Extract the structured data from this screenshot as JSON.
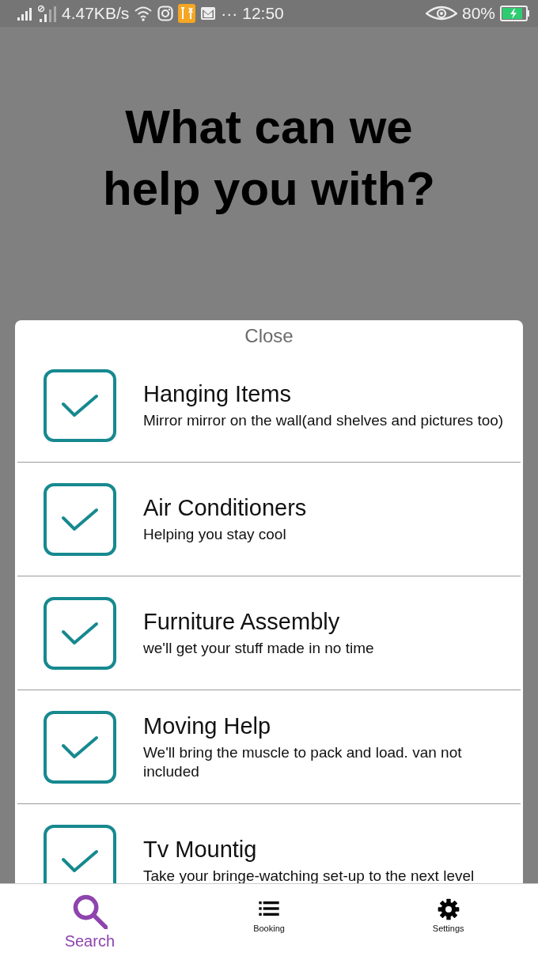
{
  "status_bar": {
    "network_speed": "4.47KB/s",
    "more": "···",
    "time": "12:50",
    "battery": "80%"
  },
  "heading": "What can we help you with?",
  "sheet": {
    "close": "Close",
    "services": [
      {
        "title": "Hanging Items",
        "subtitle": "Mirror mirror on the wall(and shelves and pictures too)",
        "checked": true
      },
      {
        "title": "Air Conditioners",
        "subtitle": "Helping you stay cool",
        "checked": true
      },
      {
        "title": "Furniture Assembly",
        "subtitle": "we'll get your stuff made in no time",
        "checked": true
      },
      {
        "title": "Moving Help",
        "subtitle": "We'll bring the muscle to pack and load. van not included",
        "checked": true
      },
      {
        "title": "Tv Mountig",
        "subtitle": "Take your bringe-watching set-up to the next level",
        "checked": true
      }
    ]
  },
  "nav": [
    {
      "kind": "search",
      "label": "Search",
      "selected": true
    },
    {
      "kind": "list",
      "label": "Booking",
      "selected": false
    },
    {
      "kind": "settings",
      "label": "Settings",
      "selected": false
    }
  ]
}
